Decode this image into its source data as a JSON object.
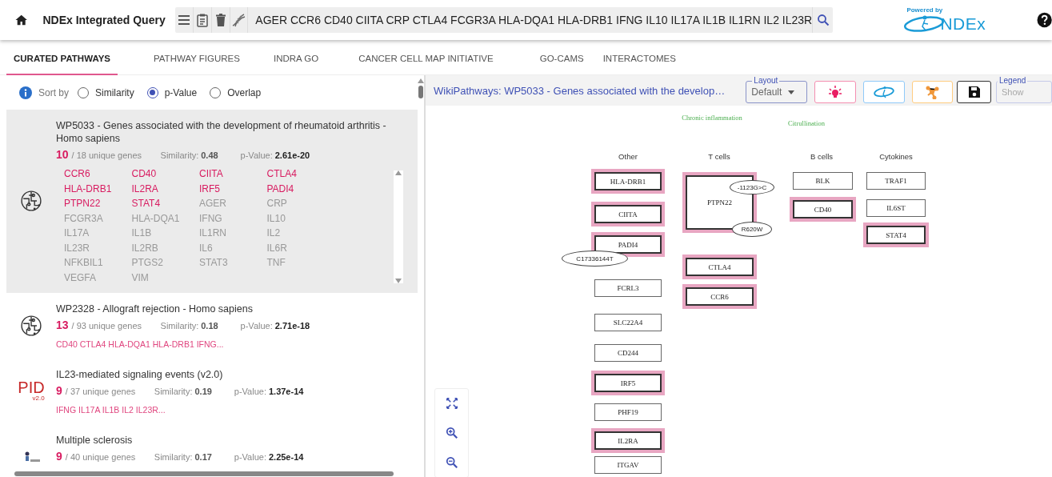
{
  "header": {
    "title": "NDEx Integrated Query",
    "query": "AGER CCR6 CD40 CIITA CRP CTLA4 FCGR3A HLA-DQA1 HLA-DRB1 IFNG IL10 IL17A IL1B IL1RN IL2 IL23R",
    "powered_by": "Powered by",
    "logo": "NDEx"
  },
  "tabs": [
    {
      "label": "CURATED PATHWAYS",
      "selected": true
    },
    {
      "label": "PATHWAY FIGURES",
      "selected": false
    },
    {
      "label": "INDRA GO",
      "selected": false
    },
    {
      "label": "CANCER CELL MAP INITIATIVE",
      "selected": false
    },
    {
      "label": "GO-CAMS",
      "selected": false
    },
    {
      "label": "INTERACTOMES",
      "selected": false
    }
  ],
  "sort": {
    "label": "Sort by",
    "options": [
      {
        "label": "Similarity",
        "selected": false
      },
      {
        "label": "p-Value",
        "selected": true
      },
      {
        "label": "Overlap",
        "selected": false
      }
    ]
  },
  "results": [
    {
      "kind": "wikipathways",
      "selected": true,
      "title": "WP5033 - Genes associated with the development of rheumatoid arthritis - Homo sapiens",
      "matched": "10",
      "total": "/ 18 unique genes",
      "similarity_label": "Similarity:",
      "similarity": "0.48",
      "pvalue_label": "p-Value:",
      "pvalue": "2.61e-20",
      "genes": [
        {
          "name": "CCR6",
          "matched": true
        },
        {
          "name": "CD40",
          "matched": true
        },
        {
          "name": "CIITA",
          "matched": true
        },
        {
          "name": "CTLA4",
          "matched": true
        },
        {
          "name": "HLA-DRB1",
          "matched": true
        },
        {
          "name": "IL2RA",
          "matched": true
        },
        {
          "name": "IRF5",
          "matched": true
        },
        {
          "name": "PADI4",
          "matched": true
        },
        {
          "name": "PTPN22",
          "matched": true
        },
        {
          "name": "STAT4",
          "matched": true
        },
        {
          "name": "AGER",
          "matched": false
        },
        {
          "name": "CRP",
          "matched": false
        },
        {
          "name": "FCGR3A",
          "matched": false
        },
        {
          "name": "HLA-DQA1",
          "matched": false
        },
        {
          "name": "IFNG",
          "matched": false
        },
        {
          "name": "IL10",
          "matched": false
        },
        {
          "name": "IL17A",
          "matched": false
        },
        {
          "name": "IL1B",
          "matched": false
        },
        {
          "name": "IL1RN",
          "matched": false
        },
        {
          "name": "IL2",
          "matched": false
        },
        {
          "name": "IL23R",
          "matched": false
        },
        {
          "name": "IL2RB",
          "matched": false
        },
        {
          "name": "IL6",
          "matched": false
        },
        {
          "name": "IL6R",
          "matched": false
        },
        {
          "name": "NFKBIL1",
          "matched": false
        },
        {
          "name": "PTGS2",
          "matched": false
        },
        {
          "name": "STAT3",
          "matched": false
        },
        {
          "name": "TNF",
          "matched": false
        },
        {
          "name": "VEGFA",
          "matched": false
        },
        {
          "name": "VIM",
          "matched": false
        }
      ]
    },
    {
      "kind": "wikipathways",
      "selected": false,
      "title": "WP2328 - Allograft rejection - Homo sapiens",
      "matched": "13",
      "total": "/ 93 unique genes",
      "similarity_label": "Similarity:",
      "similarity": "0.18",
      "pvalue_label": "p-Value:",
      "pvalue": "2.71e-18",
      "genes_summary": "CD40 CTLA4 HLA-DQA1 HLA-DRB1 IFNG..."
    },
    {
      "kind": "pid",
      "icon_text": "PID",
      "icon_version": "v2.0",
      "selected": false,
      "title": "IL23-mediated signaling events (v2.0)",
      "matched": "9",
      "total": "/ 37 unique genes",
      "similarity_label": "Similarity:",
      "similarity": "0.19",
      "pvalue_label": "p-Value:",
      "pvalue": "1.37e-14",
      "genes_summary": "IFNG IL17A IL1B IL2 IL23R..."
    },
    {
      "kind": "figure",
      "selected": false,
      "title": "Multiple sclerosis",
      "matched": "9",
      "total": "/ 40 unique genes",
      "similarity_label": "Similarity:",
      "similarity": "0.17",
      "pvalue_label": "p-Value:",
      "pvalue": "2.25e-14"
    }
  ],
  "network": {
    "title": "WikiPathways: WP5033 - Genes associated with the develop…",
    "layout": {
      "label": "Layout",
      "value": "Default"
    },
    "legend": {
      "label": "Legend",
      "value": "Show",
      "disabled": true
    },
    "annotations": [
      "Chronic inflammation",
      "Citrullination"
    ],
    "groups": [
      "Other",
      "T cells",
      "B cells",
      "Cytokines"
    ],
    "nodes": [
      {
        "label": "HLA-DRB1",
        "highlighted": true
      },
      {
        "label": "CIITA",
        "highlighted": true
      },
      {
        "label": "PADI4",
        "highlighted": true,
        "variants": [
          "C17336144T"
        ]
      },
      {
        "label": "FCRL3",
        "highlighted": false
      },
      {
        "label": "SLC22A4",
        "highlighted": false
      },
      {
        "label": "CD244",
        "highlighted": false
      },
      {
        "label": "IRF5",
        "highlighted": true
      },
      {
        "label": "PHF19",
        "highlighted": false
      },
      {
        "label": "IL2RA",
        "highlighted": true
      },
      {
        "label": "ITGAV",
        "highlighted": false
      },
      {
        "label": "PTPN22",
        "highlighted": true,
        "variants": [
          "-1123G>C",
          "R620W"
        ]
      },
      {
        "label": "CTLA4",
        "highlighted": true
      },
      {
        "label": "CCR6",
        "highlighted": true
      },
      {
        "label": "BLK",
        "highlighted": false
      },
      {
        "label": "CD40",
        "highlighted": true
      },
      {
        "label": "TRAF1",
        "highlighted": false
      },
      {
        "label": "IL6ST",
        "highlighted": false
      },
      {
        "label": "STAT4",
        "highlighted": true
      }
    ]
  }
}
